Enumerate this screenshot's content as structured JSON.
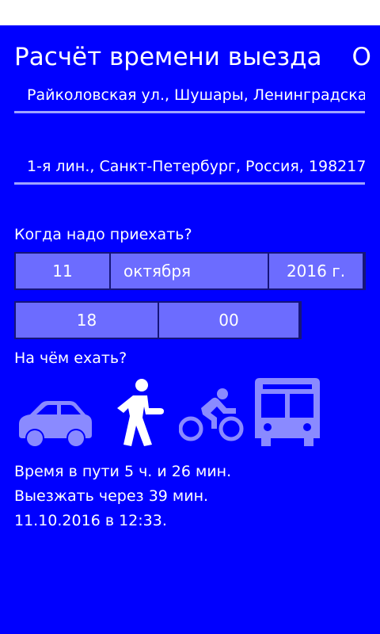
{
  "app": {
    "title": "Расчёт времени выезда",
    "next_pivot": "О п"
  },
  "route": {
    "from_value": "Райколовская ул., Шушары, Ленинградская",
    "to_value": "1-я лин., Санкт-Петербург, Россия, 198217"
  },
  "arrival": {
    "label": "Когда надо приехать?",
    "day": "11",
    "month": "октября",
    "year": "2016 г.",
    "hour": "18",
    "minute": "00"
  },
  "transport": {
    "label": "На чём ехать?",
    "modes": [
      {
        "icon": "car-icon",
        "selected": false
      },
      {
        "icon": "walk-icon",
        "selected": true
      },
      {
        "icon": "bike-icon",
        "selected": false
      },
      {
        "icon": "bus-icon",
        "selected": false
      }
    ]
  },
  "result": {
    "travel_time": "Время в пути 5 ч. и 26 мин.",
    "leave_in": "Выезжать через 39 мин.",
    "leave_at": "11.10.2016 в 12:33."
  },
  "colors": {
    "background": "#0000ff",
    "picker_cell": "#6c6cff",
    "unselected_icon": "#8a8aff",
    "selected_icon": "#ffffff"
  }
}
